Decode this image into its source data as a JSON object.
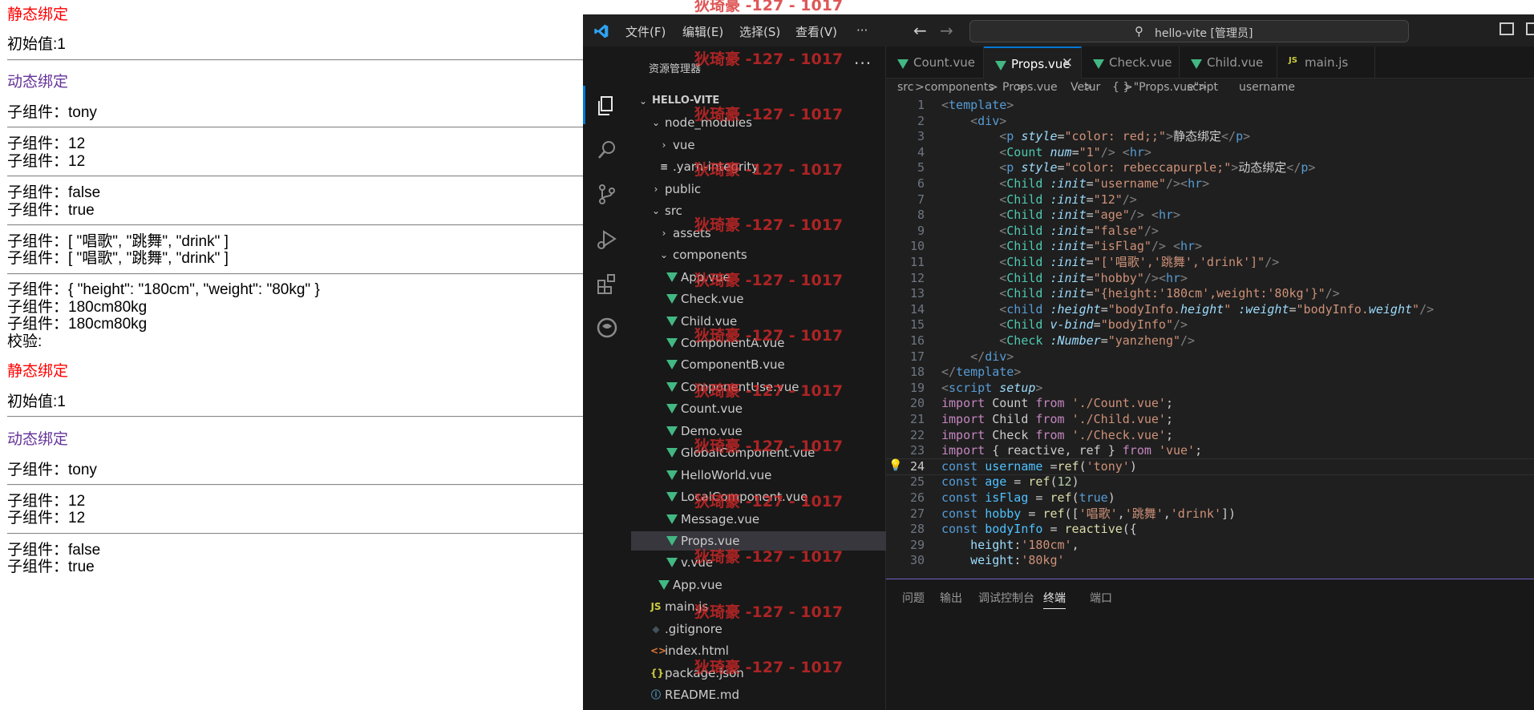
{
  "browser": {
    "lines": [
      "静态绑定",
      "初始值:1",
      "动态绑定",
      "子组件：tony",
      "子组件：12",
      "子组件：12",
      "子组件：false",
      "子组件：true",
      "子组件：[ \"唱歌\", \"跳舞\", \"drink\" ]",
      "子组件：[ \"唱歌\", \"跳舞\", \"drink\" ]",
      "子组件：{ \"height\": \"180cm\", \"weight\": \"80kg\" }",
      "子组件：180cm80kg",
      "子组件：180cm80kg",
      "校验:",
      "静态绑定",
      "初始值:1",
      "动态绑定",
      "子组件：tony",
      "子组件：12",
      "子组件：12",
      "子组件：false",
      "子组件：true"
    ],
    "colors": {
      "static": "#ff0000",
      "dynamic": "#663399"
    }
  },
  "vscode": {
    "menu": [
      "文件(F)",
      "编辑(E)",
      "选择(S)",
      "查看(V)",
      "···"
    ],
    "search": "hello-vite [管理员]",
    "explorer_title": "资源管理器",
    "explorer_more": "···",
    "tree": [
      {
        "label": "HELLO-VITE",
        "kind": "root"
      },
      {
        "label": "node_modules",
        "kind": "folder-open"
      },
      {
        "label": "vue",
        "kind": "folder"
      },
      {
        "label": ".yarn-integrity",
        "kind": "file-lines"
      },
      {
        "label": "public",
        "kind": "folder"
      },
      {
        "label": "src",
        "kind": "folder-open"
      },
      {
        "label": "assets",
        "kind": "folder"
      },
      {
        "label": "components",
        "kind": "folder-open"
      },
      {
        "label": "App.vue",
        "kind": "vue"
      },
      {
        "label": "Check.vue",
        "kind": "vue"
      },
      {
        "label": "Child.vue",
        "kind": "vue"
      },
      {
        "label": "ComponentA.vue",
        "kind": "vue"
      },
      {
        "label": "ComponentB.vue",
        "kind": "vue"
      },
      {
        "label": "ComponentUse.vue",
        "kind": "vue"
      },
      {
        "label": "Count.vue",
        "kind": "vue"
      },
      {
        "label": "Demo.vue",
        "kind": "vue"
      },
      {
        "label": "GlobalComponent.vue",
        "kind": "vue"
      },
      {
        "label": "HelloWorld.vue",
        "kind": "vue"
      },
      {
        "label": "LocalComponent.vue",
        "kind": "vue"
      },
      {
        "label": "Message.vue",
        "kind": "vue"
      },
      {
        "label": "Props.vue",
        "kind": "vue",
        "selected": true
      },
      {
        "label": "v.vue",
        "kind": "vue"
      },
      {
        "label": "App.vue",
        "kind": "vue"
      },
      {
        "label": "main.js",
        "kind": "js"
      },
      {
        "label": ".gitignore",
        "kind": "git"
      },
      {
        "label": "index.html",
        "kind": "html"
      },
      {
        "label": "package.json",
        "kind": "json"
      },
      {
        "label": "README.md",
        "kind": "info"
      }
    ],
    "tabs": [
      {
        "label": "Count.vue",
        "icon": "vue"
      },
      {
        "label": "Props.vue",
        "icon": "vue",
        "active": true,
        "close": "✕"
      },
      {
        "label": "Check.vue",
        "icon": "vue"
      },
      {
        "label": "Child.vue",
        "icon": "vue"
      },
      {
        "label": "main.js",
        "icon": "js"
      }
    ],
    "breadcrumbs": [
      "src",
      ">",
      "components",
      ">",
      "Props.vue",
      ">",
      "Vetur",
      ">",
      "{ } \"Props.vue\"",
      ">",
      "script",
      ">",
      "username"
    ],
    "current_line": 24,
    "panel_tabs": [
      "问题",
      "输出",
      "调试控制台",
      "终端",
      "端口"
    ],
    "active_panel_tab": "终端",
    "watermark": "狄琦豪 -127 - 1017",
    "code": [
      [
        [
          "<",
          "br"
        ],
        [
          "template",
          "tag"
        ],
        [
          ">",
          "br"
        ]
      ],
      [
        [
          "    "
        ],
        [
          "<",
          "br"
        ],
        [
          "div",
          "tag"
        ],
        [
          ">",
          "br"
        ]
      ],
      [
        [
          "        "
        ],
        [
          "<",
          "br"
        ],
        [
          "p",
          "tag"
        ],
        [
          " "
        ],
        [
          "style",
          "attr"
        ],
        [
          "="
        ],
        [
          "\"color: red;;\"",
          "str"
        ],
        [
          ">",
          "br"
        ],
        [
          "静态绑定"
        ],
        [
          "</",
          "br"
        ],
        [
          "p",
          "tag"
        ],
        [
          ">",
          "br"
        ]
      ],
      [
        [
          "        "
        ],
        [
          "<",
          "br"
        ],
        [
          "Count",
          "comp"
        ],
        [
          " "
        ],
        [
          "num",
          "attr"
        ],
        [
          "="
        ],
        [
          "\"1\"",
          "str"
        ],
        [
          "/>",
          "br"
        ],
        [
          " "
        ],
        [
          "<",
          "br"
        ],
        [
          "hr",
          "tag"
        ],
        [
          ">",
          "br"
        ]
      ],
      [
        [
          "        "
        ],
        [
          "<",
          "br"
        ],
        [
          "p",
          "tag"
        ],
        [
          " "
        ],
        [
          "style",
          "attr"
        ],
        [
          "="
        ],
        [
          "\"color: rebeccapurple;\"",
          "str"
        ],
        [
          ">",
          "br"
        ],
        [
          "动态绑定"
        ],
        [
          "</",
          "br"
        ],
        [
          "p",
          "tag"
        ],
        [
          ">",
          "br"
        ]
      ],
      [
        [
          "        "
        ],
        [
          "<",
          "br"
        ],
        [
          "Child",
          "comp"
        ],
        [
          " "
        ],
        [
          ":init",
          "attr"
        ],
        [
          "="
        ],
        [
          "\"username\"",
          "str"
        ],
        [
          "/>",
          "br"
        ],
        [
          "<",
          "br"
        ],
        [
          "hr",
          "tag"
        ],
        [
          ">",
          "br"
        ]
      ],
      [
        [
          "        "
        ],
        [
          "<",
          "br"
        ],
        [
          "Child",
          "comp"
        ],
        [
          " "
        ],
        [
          ":init",
          "attr"
        ],
        [
          "="
        ],
        [
          "\"12\"",
          "str"
        ],
        [
          "/>",
          "br"
        ]
      ],
      [
        [
          "        "
        ],
        [
          "<",
          "br"
        ],
        [
          "Child",
          "comp"
        ],
        [
          " "
        ],
        [
          ":init",
          "attr"
        ],
        [
          "="
        ],
        [
          "\"age\"",
          "str"
        ],
        [
          "/>",
          "br"
        ],
        [
          " "
        ],
        [
          "<",
          "br"
        ],
        [
          "hr",
          "tag"
        ],
        [
          ">",
          "br"
        ]
      ],
      [
        [
          "        "
        ],
        [
          "<",
          "br"
        ],
        [
          "Child",
          "comp"
        ],
        [
          " "
        ],
        [
          ":init",
          "attr"
        ],
        [
          "="
        ],
        [
          "\"false\"",
          "str"
        ],
        [
          "/>",
          "br"
        ]
      ],
      [
        [
          "        "
        ],
        [
          "<",
          "br"
        ],
        [
          "Child",
          "comp"
        ],
        [
          " "
        ],
        [
          ":init",
          "attr"
        ],
        [
          "="
        ],
        [
          "\"isFlag\"",
          "str"
        ],
        [
          "/>",
          "br"
        ],
        [
          " "
        ],
        [
          "<",
          "br"
        ],
        [
          "hr",
          "tag"
        ],
        [
          ">",
          "br"
        ]
      ],
      [
        [
          "        "
        ],
        [
          "<",
          "br"
        ],
        [
          "Child",
          "comp"
        ],
        [
          " "
        ],
        [
          ":init",
          "attr"
        ],
        [
          "="
        ],
        [
          "\"['唱歌','跳舞','drink']\"",
          "str"
        ],
        [
          "/>",
          "br"
        ]
      ],
      [
        [
          "        "
        ],
        [
          "<",
          "br"
        ],
        [
          "Child",
          "comp"
        ],
        [
          " "
        ],
        [
          ":init",
          "attr"
        ],
        [
          "="
        ],
        [
          "\"hobby\"",
          "str"
        ],
        [
          "/>",
          "br"
        ],
        [
          "<",
          "br"
        ],
        [
          "hr",
          "tag"
        ],
        [
          ">",
          "br"
        ]
      ],
      [
        [
          "        "
        ],
        [
          "<",
          "br"
        ],
        [
          "Child",
          "comp"
        ],
        [
          " "
        ],
        [
          ":init",
          "attr"
        ],
        [
          "="
        ],
        [
          "\"{height:'180cm',weight:'80kg'}\"",
          "str"
        ],
        [
          "/>",
          "br"
        ]
      ],
      [
        [
          "        "
        ],
        [
          "<",
          "br"
        ],
        [
          "child",
          "tag"
        ],
        [
          " "
        ],
        [
          ":height",
          "attr"
        ],
        [
          "="
        ],
        [
          "\"bodyInfo.",
          "str"
        ],
        [
          "height",
          "attr"
        ],
        [
          "\"",
          "str"
        ],
        [
          " "
        ],
        [
          ":weight",
          "attr"
        ],
        [
          "="
        ],
        [
          "\"bodyInfo.",
          "str"
        ],
        [
          "weight",
          "attr"
        ],
        [
          "\"",
          "str"
        ],
        [
          "/>",
          "br"
        ]
      ],
      [
        [
          "        "
        ],
        [
          "<",
          "br"
        ],
        [
          "Child",
          "comp"
        ],
        [
          " "
        ],
        [
          "v-bind",
          "attr"
        ],
        [
          "="
        ],
        [
          "\"bodyInfo\"",
          "str"
        ],
        [
          "/>",
          "br"
        ]
      ],
      [
        [
          "        "
        ],
        [
          "<",
          "br"
        ],
        [
          "Check",
          "comp"
        ],
        [
          " "
        ],
        [
          ":Number",
          "attr"
        ],
        [
          "="
        ],
        [
          "\"yanzheng\"",
          "str"
        ],
        [
          "/>",
          "br"
        ]
      ],
      [
        [
          "    "
        ],
        [
          "</",
          "br"
        ],
        [
          "div",
          "tag"
        ],
        [
          ">",
          "br"
        ]
      ],
      [
        [
          "</",
          "br"
        ],
        [
          "template",
          "tag"
        ],
        [
          ">",
          "br"
        ]
      ],
      [
        [
          "<",
          "br"
        ],
        [
          "script",
          "tag"
        ],
        [
          " "
        ],
        [
          "setup",
          "attr"
        ],
        [
          ">",
          "br"
        ]
      ],
      [
        [
          "import",
          "kw2"
        ],
        [
          " Count "
        ],
        [
          "from",
          "kw2"
        ],
        [
          " "
        ],
        [
          "'./Count.vue'",
          "str"
        ],
        [
          ";"
        ]
      ],
      [
        [
          "import",
          "kw2"
        ],
        [
          " Child "
        ],
        [
          "from",
          "kw2"
        ],
        [
          " "
        ],
        [
          "'./Child.vue'",
          "str"
        ],
        [
          ";"
        ]
      ],
      [
        [
          "import",
          "kw2"
        ],
        [
          " Check "
        ],
        [
          "from",
          "kw2"
        ],
        [
          " "
        ],
        [
          "'./Check.vue'",
          "str"
        ],
        [
          ";"
        ]
      ],
      [
        [
          "import",
          "kw2"
        ],
        [
          " { reactive, ref } "
        ],
        [
          "from",
          "kw2"
        ],
        [
          " "
        ],
        [
          "'vue'",
          "str"
        ],
        [
          ";"
        ]
      ],
      [
        [
          "const",
          "kw"
        ],
        [
          " "
        ],
        [
          "username",
          "var"
        ],
        [
          " ="
        ],
        [
          "ref",
          "fn"
        ],
        [
          "("
        ],
        [
          "'tony'",
          "str"
        ],
        [
          ")"
        ]
      ],
      [
        [
          "const",
          "kw"
        ],
        [
          " "
        ],
        [
          "age",
          "var"
        ],
        [
          " = "
        ],
        [
          "ref",
          "fn"
        ],
        [
          "("
        ],
        [
          "12",
          "num"
        ],
        [
          ")"
        ]
      ],
      [
        [
          "const",
          "kw"
        ],
        [
          " "
        ],
        [
          "isFlag",
          "var"
        ],
        [
          " = "
        ],
        [
          "ref",
          "fn"
        ],
        [
          "("
        ],
        [
          "true",
          "kw"
        ],
        [
          ")"
        ]
      ],
      [
        [
          "const",
          "kw"
        ],
        [
          " "
        ],
        [
          "hobby",
          "var"
        ],
        [
          " = "
        ],
        [
          "ref",
          "fn"
        ],
        [
          "(["
        ],
        [
          "'唱歌'",
          "str"
        ],
        [
          ","
        ],
        [
          "'跳舞'",
          "str"
        ],
        [
          ","
        ],
        [
          "'drink'",
          "str"
        ],
        [
          "])"
        ]
      ],
      [
        [
          "const",
          "kw"
        ],
        [
          " "
        ],
        [
          "bodyInfo",
          "var"
        ],
        [
          " = "
        ],
        [
          "reactive",
          "fn"
        ],
        [
          "({"
        ]
      ],
      [
        [
          "    "
        ],
        [
          "height",
          "prop"
        ],
        [
          ":"
        ],
        [
          "'180cm'",
          "str"
        ],
        [
          ","
        ]
      ],
      [
        [
          "    "
        ],
        [
          "weight",
          "prop"
        ],
        [
          ":"
        ],
        [
          "'80kg'",
          "str"
        ]
      ]
    ]
  }
}
